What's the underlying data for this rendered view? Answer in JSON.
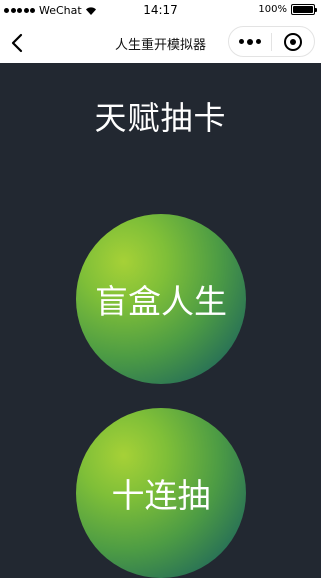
{
  "status_bar": {
    "carrier": "WeChat",
    "time": "14:17",
    "battery": "100%"
  },
  "nav": {
    "title": "人生重开模拟器"
  },
  "page": {
    "title": "天赋抽卡"
  },
  "buttons": {
    "blind_box": "盲盒人生",
    "ten_draw": "十连抽"
  },
  "colors": {
    "background": "#222831",
    "orb_highlight": "#a6d137",
    "orb_edge": "#1f5e66"
  }
}
